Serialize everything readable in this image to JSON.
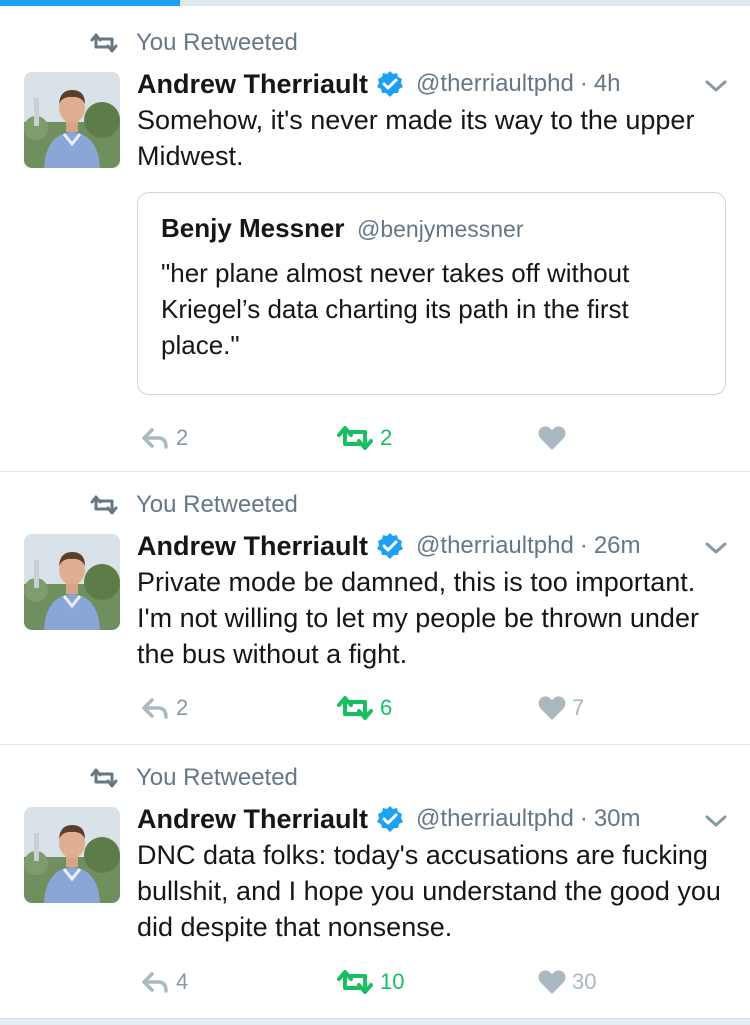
{
  "page": {
    "load_progress": 0.24
  },
  "colors": {
    "accent": "#1da1f2",
    "retweet_green": "#17bf63",
    "verified": "#1da1f2",
    "secondary": "#657786"
  },
  "tweets": [
    {
      "retweet_label": "You Retweeted",
      "name": "Andrew Therriault",
      "handle": "@therriaultphd",
      "separator": "·",
      "time": "4h",
      "text": "Somehow, it's never made its way to the upper Midwest.",
      "quote": {
        "name": "Benjy Messner",
        "handle": "@benjymessner",
        "text": "\"her plane almost never takes off without Kriegel’s data charting its path in the first place.\""
      },
      "replies": "2",
      "retweets": "2",
      "likes": ""
    },
    {
      "retweet_label": "You Retweeted",
      "name": "Andrew Therriault",
      "handle": "@therriaultphd",
      "separator": "·",
      "time": "26m",
      "text": "Private mode be damned, this is too important. I'm not willing to let my people be thrown under the bus without a fight.",
      "replies": "2",
      "retweets": "6",
      "likes": "7"
    },
    {
      "retweet_label": "You Retweeted",
      "name": "Andrew Therriault",
      "handle": "@therriaultphd",
      "separator": "·",
      "time": "30m",
      "text": "DNC data folks: today's accusations are fucking bullshit, and I hope you understand the good you did despite that nonsense.",
      "replies": "4",
      "retweets": "10",
      "likes": "30"
    }
  ],
  "icons": {
    "retweet": "retweet-icon",
    "verified": "verified-badge-icon",
    "chevron": "chevron-down-icon",
    "reply": "reply-icon",
    "like": "heart-icon"
  }
}
